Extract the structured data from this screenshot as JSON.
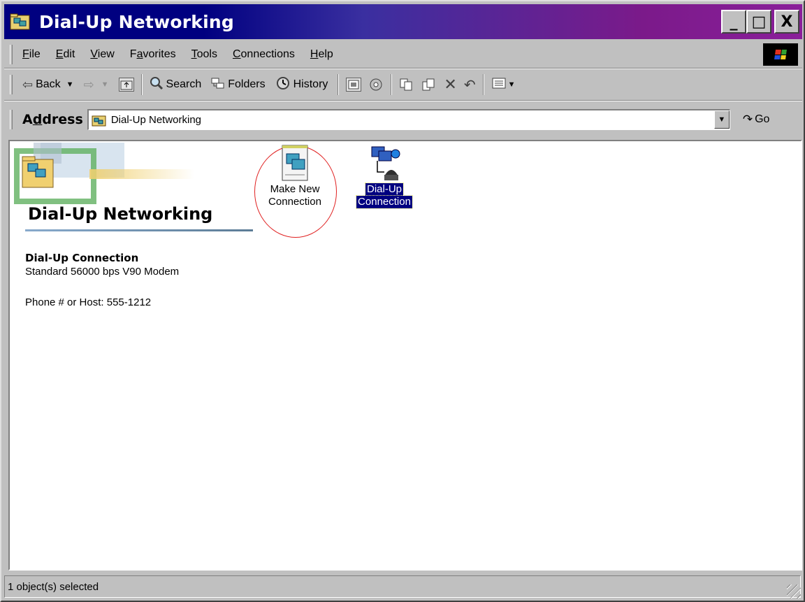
{
  "window": {
    "title": "Dial-Up Networking",
    "buttons": {
      "minimize": "_",
      "maximize": "□",
      "close": "X"
    }
  },
  "menubar": {
    "items": [
      {
        "label": "File",
        "underline": "F",
        "rest": "ile"
      },
      {
        "label": "Edit",
        "underline": "E",
        "rest": "dit"
      },
      {
        "label": "View",
        "underline": "V",
        "rest": "iew"
      },
      {
        "label": "Favorites",
        "pre": "F",
        "underline": "a",
        "rest": "vorites"
      },
      {
        "label": "Tools",
        "underline": "T",
        "rest": "ools"
      },
      {
        "label": "Connections",
        "underline": "C",
        "rest": "onnections"
      },
      {
        "label": "Help",
        "underline": "H",
        "rest": "elp"
      }
    ]
  },
  "toolbar": {
    "back": "Back",
    "search": "Search",
    "folders": "Folders",
    "history": "History"
  },
  "address": {
    "label": "Address",
    "value": "Dial-Up Networking",
    "go": "Go"
  },
  "content": {
    "banner_title": "Dial-Up Networking",
    "info_title": "Dial-Up Connection",
    "info_device": "Standard 56000 bps V90 Modem",
    "info_phone": "Phone # or Host: 555-1212",
    "icons": [
      {
        "label_line1": "Make New",
        "label_line2": "Connection",
        "selected": false
      },
      {
        "label_line1": "Dial-Up",
        "label_line2": "Connection",
        "selected": true
      }
    ]
  },
  "status": {
    "text": "1 object(s) selected"
  },
  "colors": {
    "titlebar_start": "#000080",
    "titlebar_end": "#8a1f9a",
    "selection": "#000080",
    "annotation_circle": "#e02020"
  }
}
